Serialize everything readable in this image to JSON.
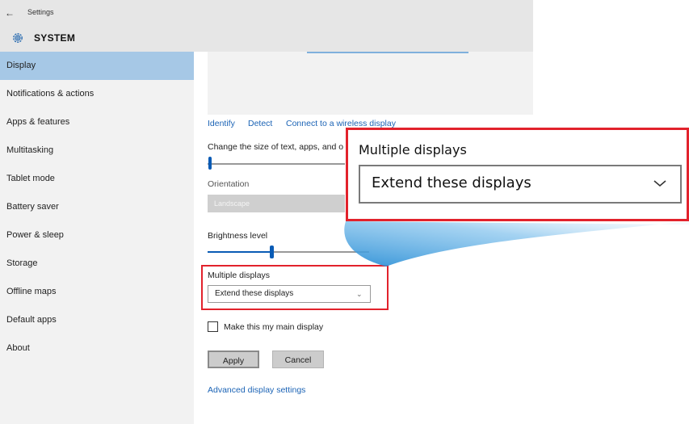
{
  "titlebar": {
    "back_glyph": "←",
    "app_title": "Settings"
  },
  "header": {
    "title": "SYSTEM",
    "icon": "gear-icon"
  },
  "sidebar": {
    "items": [
      {
        "label": "Display",
        "active": true
      },
      {
        "label": "Notifications & actions"
      },
      {
        "label": "Apps & features"
      },
      {
        "label": "Multitasking"
      },
      {
        "label": "Tablet mode"
      },
      {
        "label": "Battery saver"
      },
      {
        "label": "Power & sleep"
      },
      {
        "label": "Storage"
      },
      {
        "label": "Offline maps"
      },
      {
        "label": "Default apps"
      },
      {
        "label": "About"
      }
    ]
  },
  "display": {
    "links": {
      "identify": "Identify",
      "detect": "Detect",
      "wireless": "Connect to a wireless display"
    },
    "scale_label": "Change the size of text, apps, and o",
    "orientation_label": "Orientation",
    "orientation_value": "Landscape",
    "brightness_label": "Brightness level",
    "multiple_label": "Multiple displays",
    "multiple_value": "Extend these displays",
    "main_display_label": "Make this my main display",
    "apply": "Apply",
    "cancel": "Cancel",
    "advanced_link": "Advanced display settings"
  },
  "zoom": {
    "label": "Multiple displays",
    "value": "Extend these displays"
  },
  "colors": {
    "accent": "#0a5bb5",
    "highlight": "#e2222c",
    "selected_nav": "#a6c8e6"
  }
}
